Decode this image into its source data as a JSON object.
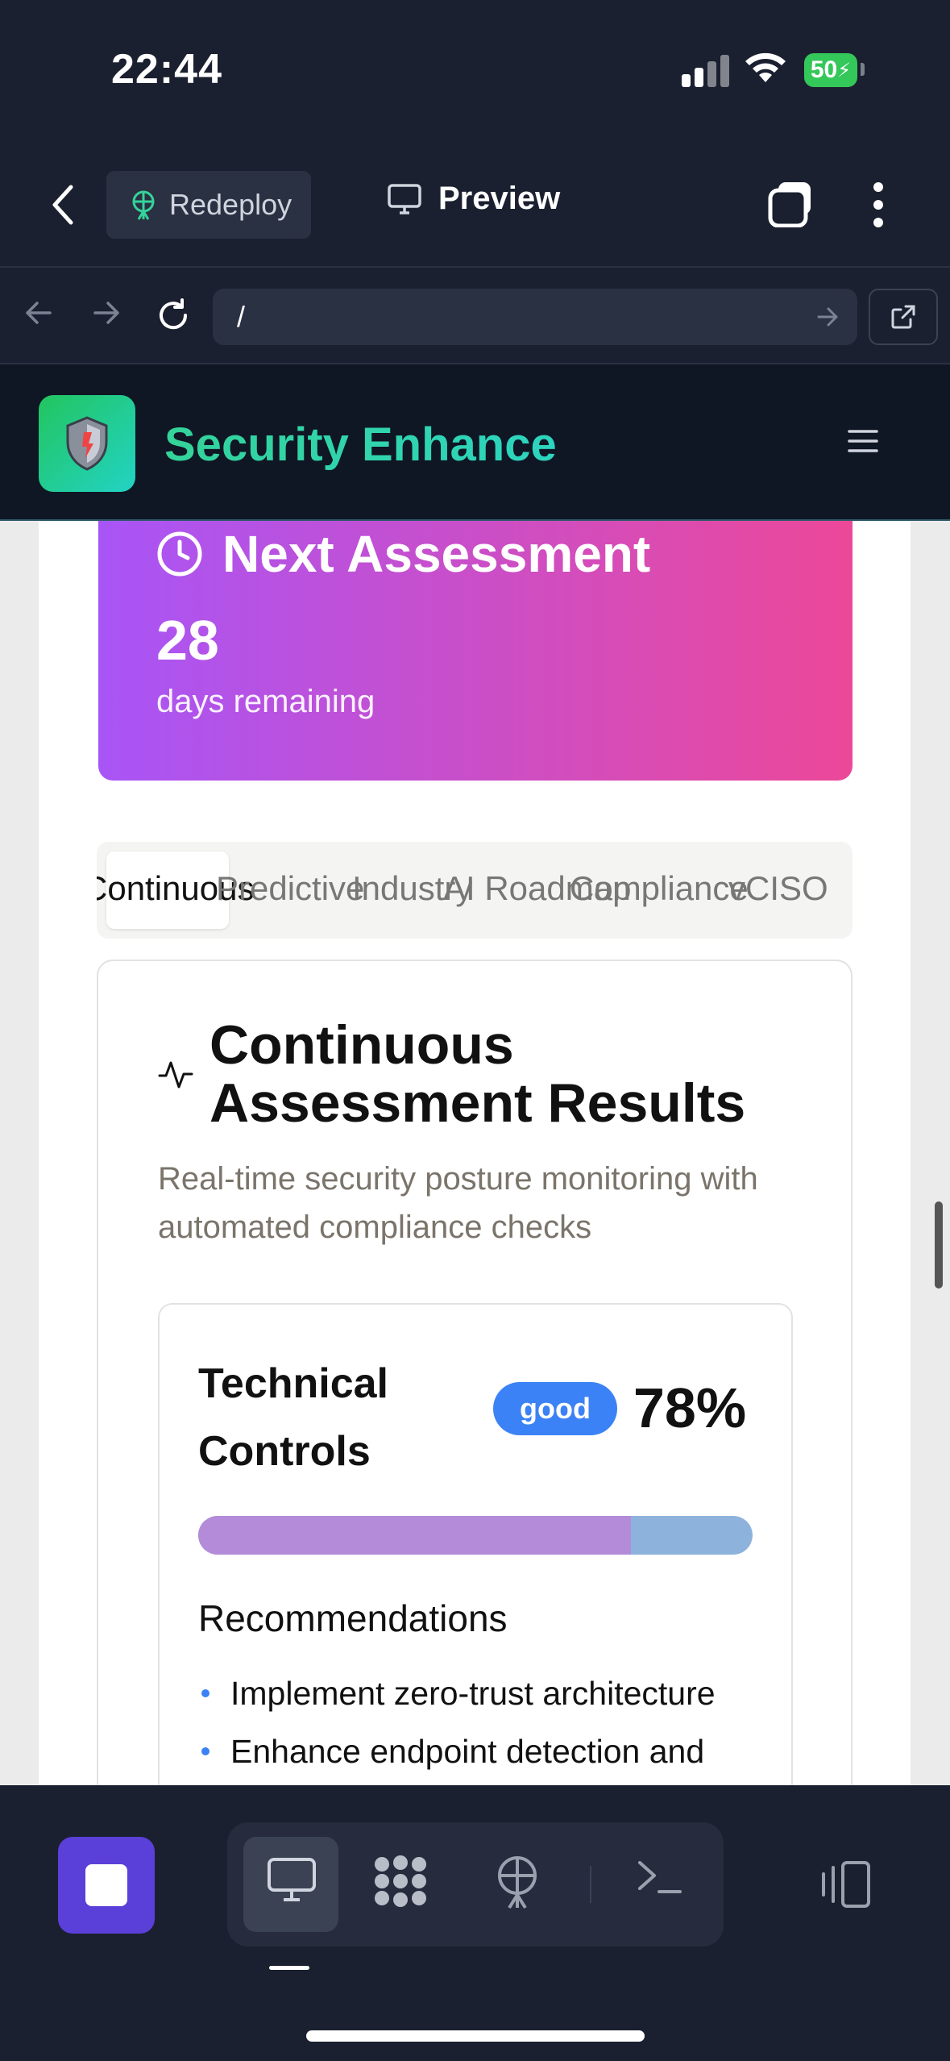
{
  "status_bar": {
    "time": "22:44",
    "battery": "50"
  },
  "app_bar": {
    "redeploy_label": "Redeploy",
    "preview_label": "Preview"
  },
  "url_bar": {
    "url": "/"
  },
  "site": {
    "title": "Security Enhance"
  },
  "assessment": {
    "title": "Next Assessment",
    "days": "28",
    "days_label": "days remaining"
  },
  "tabs": [
    {
      "label": "Continuous"
    },
    {
      "label": "Predictive"
    },
    {
      "label": "Industry"
    },
    {
      "label": "AI Roadmap"
    },
    {
      "label": "Compliance"
    },
    {
      "label": "vCISO"
    }
  ],
  "results": {
    "title": "Continuous Assessment Results",
    "description": "Real-time security posture monitoring with automated compliance checks"
  },
  "metric": {
    "name": "Technical Controls",
    "badge": "good",
    "percent_label": "78%",
    "percent_value": 78,
    "recommendations_title": "Recommendations",
    "recommendations": [
      "Implement zero-trust architecture",
      "Enhance endpoint detection and"
    ]
  },
  "colors": {
    "accent_purple": "#a855f7",
    "accent_pink": "#ec4899",
    "badge_blue": "#3b82f6",
    "brand_green": "#34d399"
  },
  "icons": {
    "back": "chevron-left-icon",
    "redeploy": "antenna-icon",
    "preview": "monitor-icon",
    "tabs": "tabs-icon",
    "more": "more-vertical-icon",
    "reload": "reload-icon",
    "external": "external-link-icon",
    "menu": "hamburger-icon",
    "clock": "clock-icon",
    "pulse": "activity-icon"
  }
}
